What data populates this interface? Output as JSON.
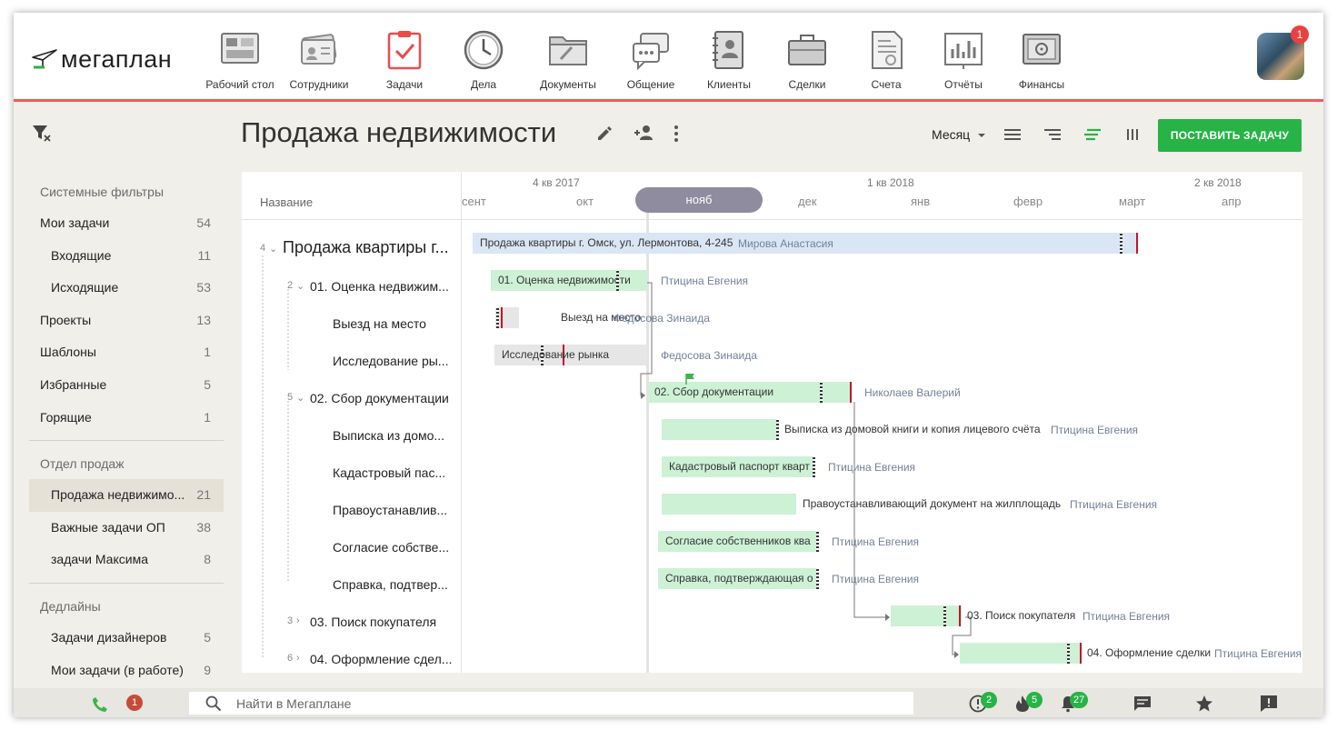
{
  "app": {
    "logo": "мегаплан",
    "avatar_badge": "1"
  },
  "nav": [
    {
      "label": "Рабочий стол",
      "icon": "desktop-icon"
    },
    {
      "label": "Сотрудники",
      "icon": "employees-icon"
    },
    {
      "label": "Задачи",
      "icon": "tasks-icon",
      "active": true
    },
    {
      "label": "Дела",
      "icon": "clock-icon"
    },
    {
      "label": "Документы",
      "icon": "folder-icon"
    },
    {
      "label": "Общение",
      "icon": "chat-icon"
    },
    {
      "label": "Клиенты",
      "icon": "contacts-book-icon"
    },
    {
      "label": "Сделки",
      "icon": "briefcase-icon"
    },
    {
      "label": "Счета",
      "icon": "invoice-icon"
    },
    {
      "label": "Отчёты",
      "icon": "report-chart-icon"
    },
    {
      "label": "Финансы",
      "icon": "safe-icon"
    }
  ],
  "sidebar": {
    "system_header": "Системные фильтры",
    "system_items": [
      {
        "label": "Мои задачи",
        "count": "54"
      },
      {
        "label": "Входящие",
        "count": "11"
      },
      {
        "label": "Исходящие",
        "count": "53"
      },
      {
        "label": "Проекты",
        "count": "13"
      },
      {
        "label": "Шаблоны",
        "count": "1"
      },
      {
        "label": "Избранные",
        "count": "5"
      },
      {
        "label": "Горящие",
        "count": "1"
      }
    ],
    "dept_header": "Отдел продаж",
    "dept_items": [
      {
        "label": "Продажа недвижимо...",
        "count": "21"
      },
      {
        "label": "Важные задачи ОП",
        "count": "38"
      },
      {
        "label": "задачи Максима",
        "count": "8"
      }
    ],
    "deadline_header": "Дедлайны",
    "deadline_items": [
      {
        "label": "Задачи дизайнеров",
        "count": "5"
      },
      {
        "label": "Мои задачи (в работе)",
        "count": "9"
      }
    ]
  },
  "title": "Продажа недвижимости",
  "view_select": "Месяц",
  "cta_label": "ПОСТАВИТЬ ЗАДАЧУ",
  "gantt": {
    "name_header": "Название",
    "quarters": [
      "4 кв 2017",
      "1 кв 2018",
      "2 кв 2018"
    ],
    "months": [
      "сент",
      "окт",
      "нояб",
      "дек",
      "янв",
      "февр",
      "март",
      "апр"
    ],
    "current_month": "нояб",
    "tree": [
      {
        "num": "4",
        "label": "Продажа квартиры г..."
      },
      {
        "num": "2",
        "label": "01. Оценка недвижим..."
      },
      {
        "num": "",
        "label": "Выезд на место"
      },
      {
        "num": "",
        "label": "Исследование ры..."
      },
      {
        "num": "5",
        "label": "02. Сбор документации"
      },
      {
        "num": "",
        "label": "Выписка из домо..."
      },
      {
        "num": "",
        "label": "Кадастровый пас..."
      },
      {
        "num": "",
        "label": "Правоустанавлив..."
      },
      {
        "num": "",
        "label": "Согласие собстве..."
      },
      {
        "num": "",
        "label": "Справка, подтвер..."
      },
      {
        "num": "3",
        "label": "03. Поиск покупателя"
      },
      {
        "num": "6",
        "label": "04. Оформление сдел..."
      }
    ],
    "bars": [
      {
        "text": "Продажа квартиры г. Омск, ул. Лермонтова, 4-245",
        "assignee": "Мирова Анастасия"
      },
      {
        "text": "01. Оценка недвижимости",
        "assignee": "Птицина Евгения"
      },
      {
        "text": "Выезд на место",
        "assignee": "Федосова Зинаида"
      },
      {
        "text": "Исследование рынка",
        "assignee": "Федосова Зинаида"
      },
      {
        "text": "02. Сбор документации",
        "assignee": "Николаев Валерий"
      },
      {
        "text": "Выписка из домовой книги и копия лицевого счёта",
        "assignee": "Птицина Евгения"
      },
      {
        "text": "Кадастровый паспорт кварт",
        "assignee": "Птицина Евгения"
      },
      {
        "text": "Правоустанавливающий документ на жилплощадь",
        "assignee": "Птицина Евгения"
      },
      {
        "text": "Согласие собственников ква",
        "assignee": "Птицина Евгения"
      },
      {
        "text": "Справка, подтверждающая о",
        "assignee": "Птицина Евгения"
      },
      {
        "text": "03. Поиск покупателя",
        "assignee": "Птицина Евгения"
      },
      {
        "text": "04. Оформление сделки",
        "assignee": "Птицина Евгения"
      }
    ]
  },
  "bottom": {
    "search_placeholder": "Найти в Мегаплане",
    "phone_badge": "1",
    "alerts_badge": "2",
    "hot_badge": "5",
    "notif_badge": "27"
  },
  "colors": {
    "accent": "#f05a5a",
    "cta": "#27b346",
    "bar_green": "#cdf1d5",
    "bar_blue": "#dbe6f4",
    "bar_gray": "#e6e6e6",
    "deadline": "#c0142c"
  }
}
